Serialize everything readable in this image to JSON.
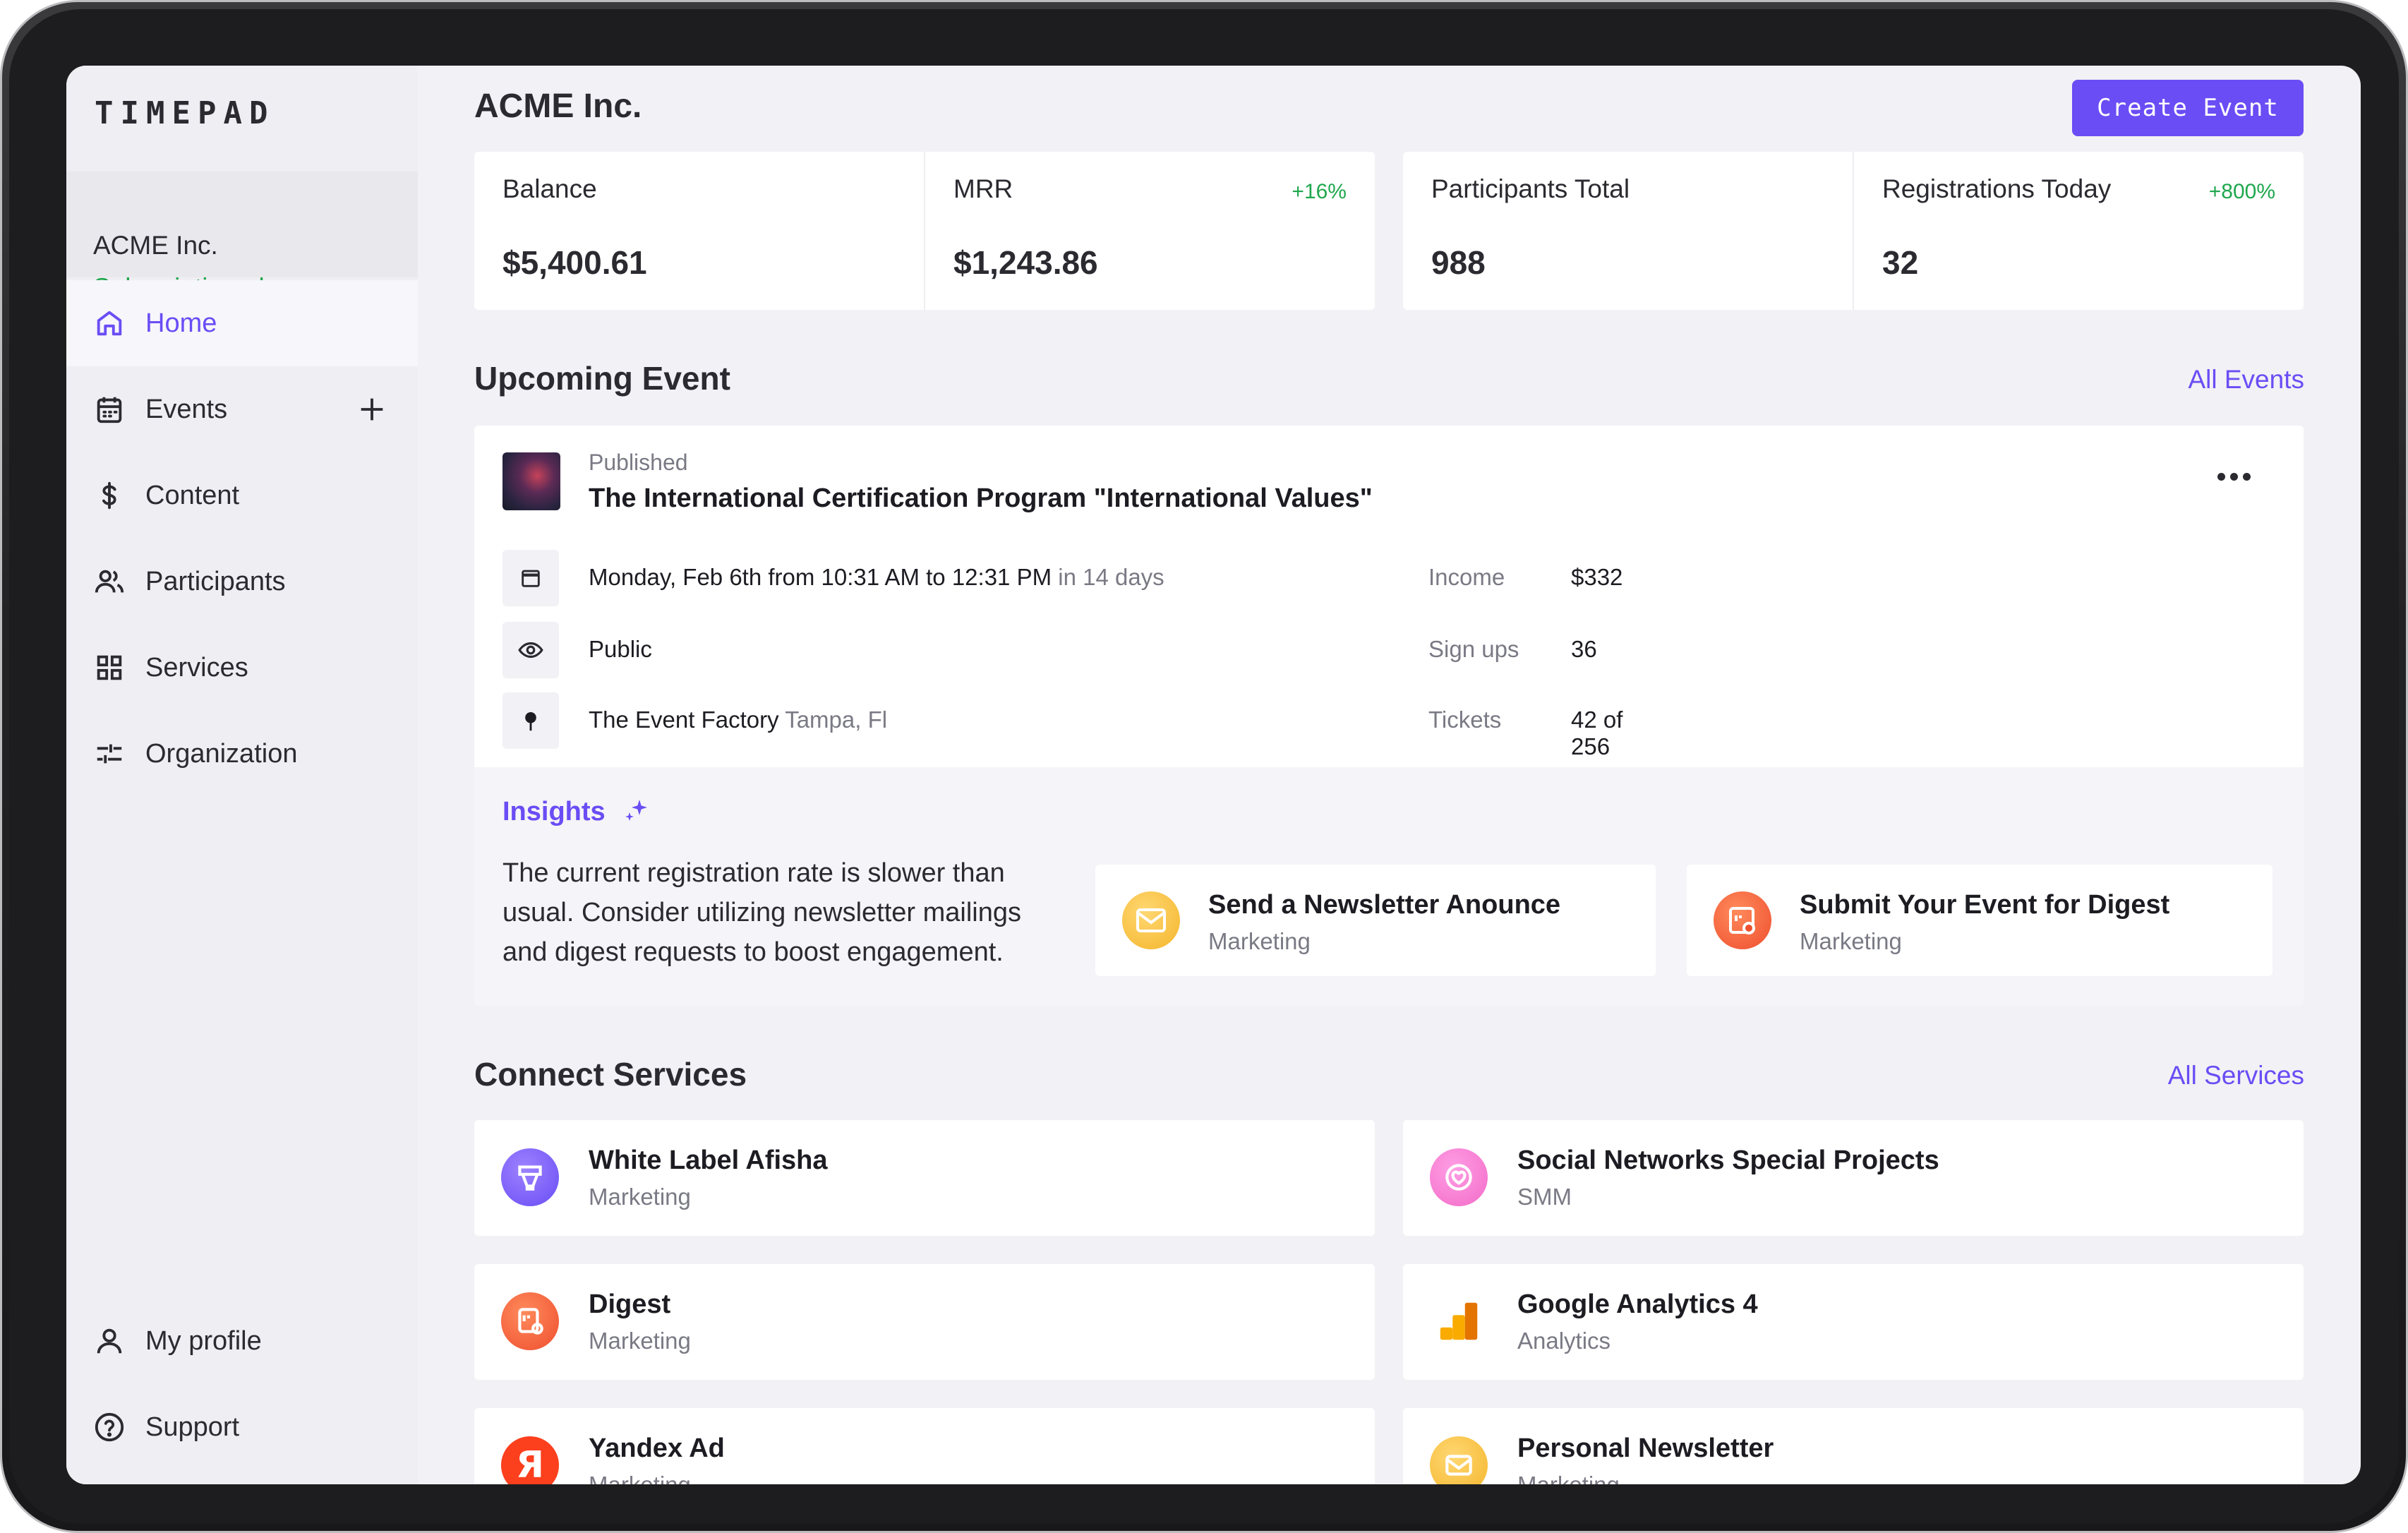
{
  "brand": {
    "logo": "TIMEPAD",
    "accent": "#6a4df5",
    "positive": "#1fa74d"
  },
  "sidebar": {
    "org_name": "ACME Inc.",
    "org_plan": "Subscription plan",
    "items": [
      {
        "label": "Home",
        "icon": "home-icon",
        "active": true
      },
      {
        "label": "Events",
        "icon": "calendar-icon"
      },
      {
        "label": "Content",
        "icon": "dollar-icon"
      },
      {
        "label": "Participants",
        "icon": "users-icon"
      },
      {
        "label": "Services",
        "icon": "grid-icon"
      },
      {
        "label": "Organization",
        "icon": "sliders-icon"
      }
    ],
    "bottom": [
      {
        "label": "My profile",
        "icon": "user-icon"
      },
      {
        "label": "Support",
        "icon": "help-icon"
      }
    ]
  },
  "header": {
    "title": "ACME Inc.",
    "create_button": "Create Event"
  },
  "stats": [
    {
      "label": "Balance",
      "value": "$5,400.61",
      "delta": ""
    },
    {
      "label": "MRR",
      "value": "$1,243.86",
      "delta": "+16%"
    },
    {
      "label": "Participants Total",
      "value": "988",
      "delta": ""
    },
    {
      "label": "Registrations Today",
      "value": "32",
      "delta": "+800%"
    }
  ],
  "upcoming": {
    "section_title": "Upcoming Event",
    "link": "All Events",
    "status": "Published",
    "name": "The International Certification Program \"International Values\"",
    "date": "Monday, Feb 6th from 10:31 AM to 12:31 PM",
    "date_relative": "in 14 days",
    "visibility": "Public",
    "venue": "The Event Factory",
    "venue_city": "Tampa, Fl",
    "metrics": [
      {
        "label": "Income",
        "value": "$332"
      },
      {
        "label": "Sign ups",
        "value": "36"
      },
      {
        "label": "Tickets",
        "value": "42 of 256"
      }
    ],
    "insights": {
      "title": "Insights",
      "text": "The current registration rate is slower than usual. Consider utilizing newsletter mailings and digest requests to boost engagement.",
      "actions": [
        {
          "title": "Send a Newsletter Anounce",
          "subtitle": "Marketing",
          "icon": "newsletter-icon"
        },
        {
          "title": "Submit Your Event for Digest",
          "subtitle": "Marketing",
          "icon": "digest-icon"
        }
      ]
    }
  },
  "services": {
    "section_title": "Connect Services",
    "link": "All Services",
    "items": [
      {
        "title": "White Label Afisha",
        "subtitle": "Marketing",
        "icon": "afisha-icon"
      },
      {
        "title": "Social Networks Special Projects",
        "subtitle": "SMM",
        "icon": "social-icon"
      },
      {
        "title": "Digest",
        "subtitle": "Marketing",
        "icon": "digest-icon"
      },
      {
        "title": "Google Analytics 4",
        "subtitle": "Analytics",
        "icon": "analytics-icon"
      },
      {
        "title": "Yandex Ad",
        "subtitle": "Marketing",
        "icon": "yandex-icon"
      },
      {
        "title": "Personal Newsletter",
        "subtitle": "Marketing",
        "icon": "newsletter-icon"
      }
    ]
  }
}
